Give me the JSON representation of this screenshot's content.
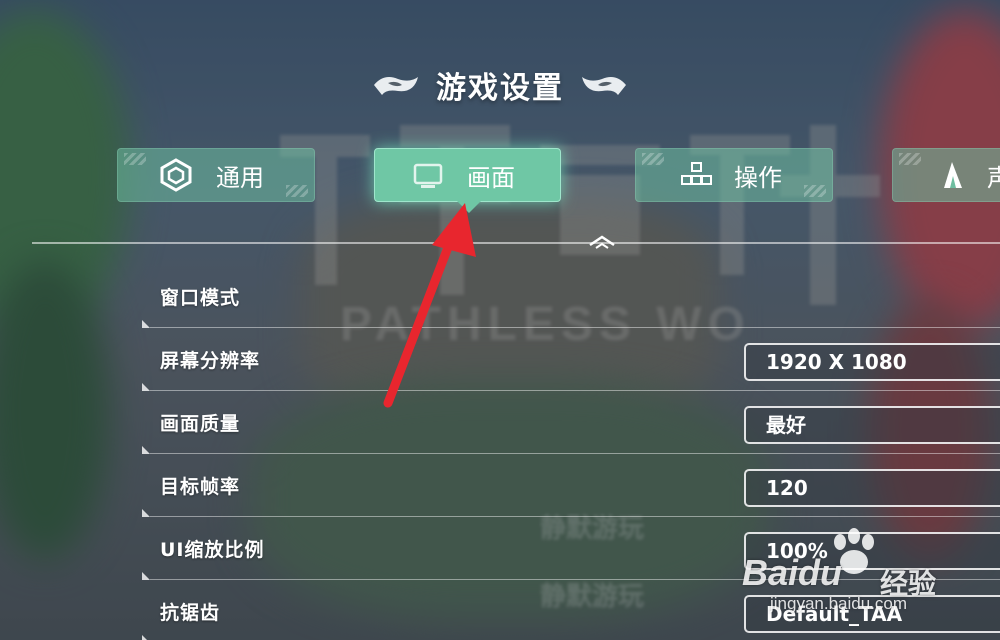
{
  "header": {
    "title": "游戏设置",
    "ornament_icon": "swirl-ornament-icon"
  },
  "background": {
    "logo_letters": "PATHLESS WO",
    "ghost_text_1": "静默游玩",
    "ghost_text_2": "静默游玩"
  },
  "tabs": [
    {
      "id": "general",
      "label": "通用",
      "icon": "gear-cube-icon",
      "active": false
    },
    {
      "id": "display",
      "label": "画面",
      "icon": "monitor-icon",
      "active": true
    },
    {
      "id": "controls",
      "label": "操作",
      "icon": "blocks-icon",
      "active": false
    },
    {
      "id": "audio",
      "label": "声",
      "icon": "sound-icon",
      "active": false
    }
  ],
  "settings": {
    "window_mode": {
      "label": "窗口模式",
      "value": ""
    },
    "resolution": {
      "label": "屏幕分辨率",
      "value": "1920 X 1080"
    },
    "quality": {
      "label": "画面质量",
      "value": "最好"
    },
    "target_fps": {
      "label": "目标帧率",
      "value": "120"
    },
    "ui_scale": {
      "label": "UI缩放比例",
      "value": "100%"
    },
    "anti_aliasing": {
      "label": "抗锯齿",
      "value": "Default_TAA"
    }
  },
  "annotation": {
    "type": "red-arrow",
    "color": "#e8262e",
    "points_to": "tab-display"
  },
  "watermark": {
    "brand": "Baidu",
    "brand_suffix": "经验",
    "url": "jingyan.baidu.com"
  },
  "colors": {
    "tab_bg": "#6ebea0",
    "tab_active": "#6fc7a5",
    "text": "#ffffff"
  }
}
